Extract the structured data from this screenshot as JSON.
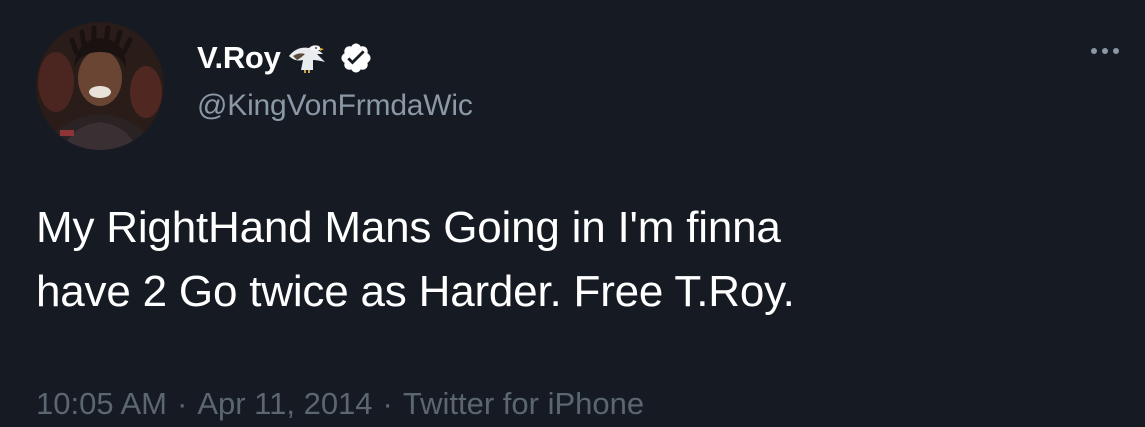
{
  "tweet": {
    "author": {
      "display_name": "V.Roy",
      "handle": "@KingVonFrmdaWic",
      "name_emoji_icon": "eagle-icon",
      "verified_icon": "verified-badge-icon",
      "avatar_alt": "profile photo"
    },
    "text": "My RightHand Mans Going in I'm finna\nhave 2 Go twice as Harder. Free T.Roy.",
    "time": "10:05 AM",
    "date": "Apr 11, 2014",
    "separator": "·",
    "source": "Twitter for iPhone",
    "more_icon": "more-options-icon"
  },
  "colors": {
    "background": "#151a23",
    "text": "#ffffff",
    "secondary_text": "#8b98a5",
    "meta_text": "#5b6670"
  }
}
